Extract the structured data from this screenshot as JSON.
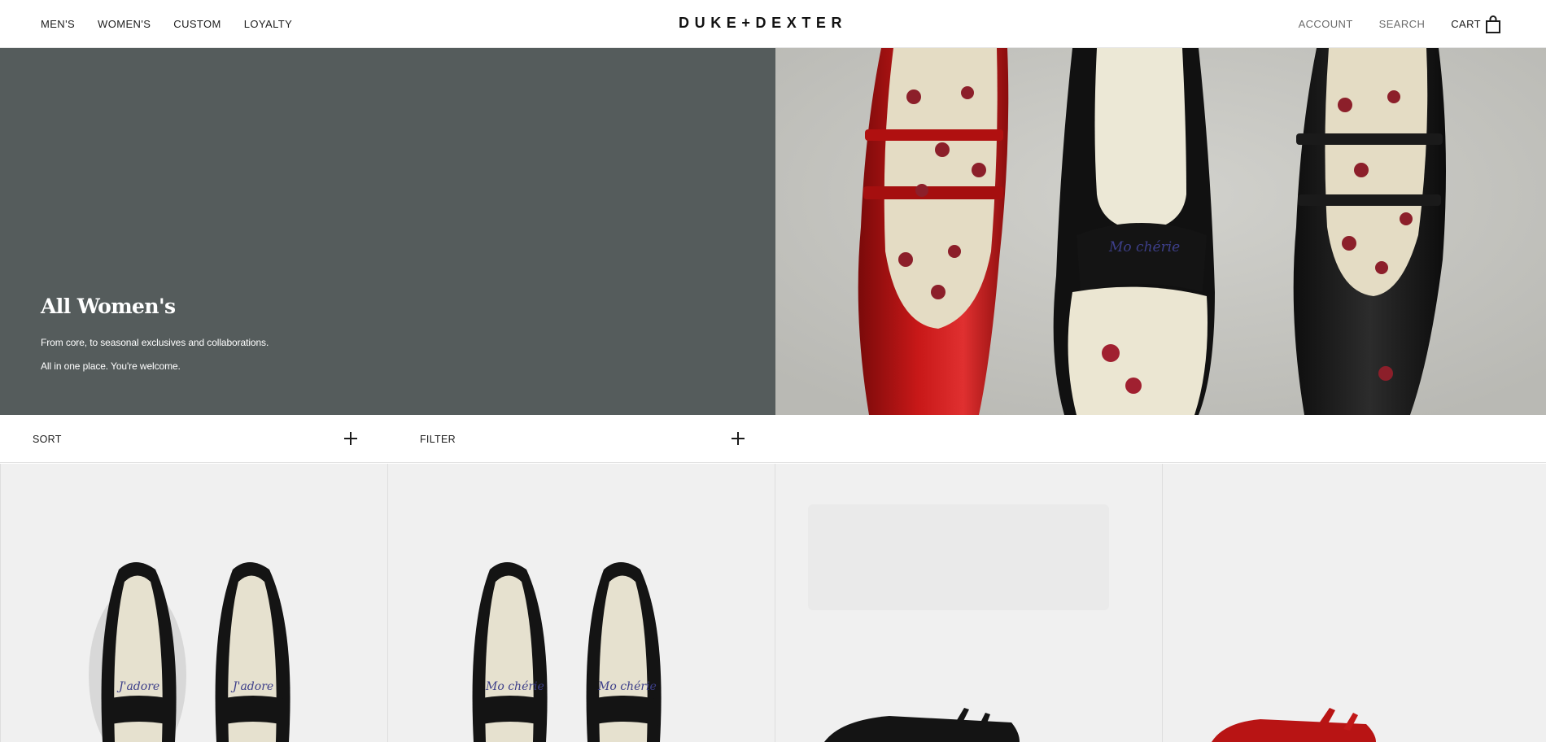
{
  "header": {
    "nav_left": [
      {
        "label": "MEN'S"
      },
      {
        "label": "WOMEN'S"
      },
      {
        "label": "CUSTOM"
      },
      {
        "label": "LOYALTY"
      }
    ],
    "logo": "DUKE+DEXTER",
    "account": "ACCOUNT",
    "search": "SEARCH",
    "cart": "CART",
    "cart_icon": "shopping-bag-icon"
  },
  "hero": {
    "title": "All Women's",
    "description_line1": "From core, to seasonal exclusives and collaborations.",
    "description_line2": "All in one place. You're welcome.",
    "background_color": "#555c5c",
    "image_embroidery": "Mo chérie"
  },
  "toolbar": {
    "sort_label": "SORT",
    "filter_label": "FILTER",
    "expand_icon": "plus-icon"
  },
  "products": [
    {
      "name": "penny-loafer-black-jadore",
      "embroidery": "J'adore"
    },
    {
      "name": "penny-loafer-black-mocherie",
      "embroidery": "Mo chérie"
    },
    {
      "name": "mary-jane-black"
    },
    {
      "name": "mary-jane-red"
    }
  ]
}
